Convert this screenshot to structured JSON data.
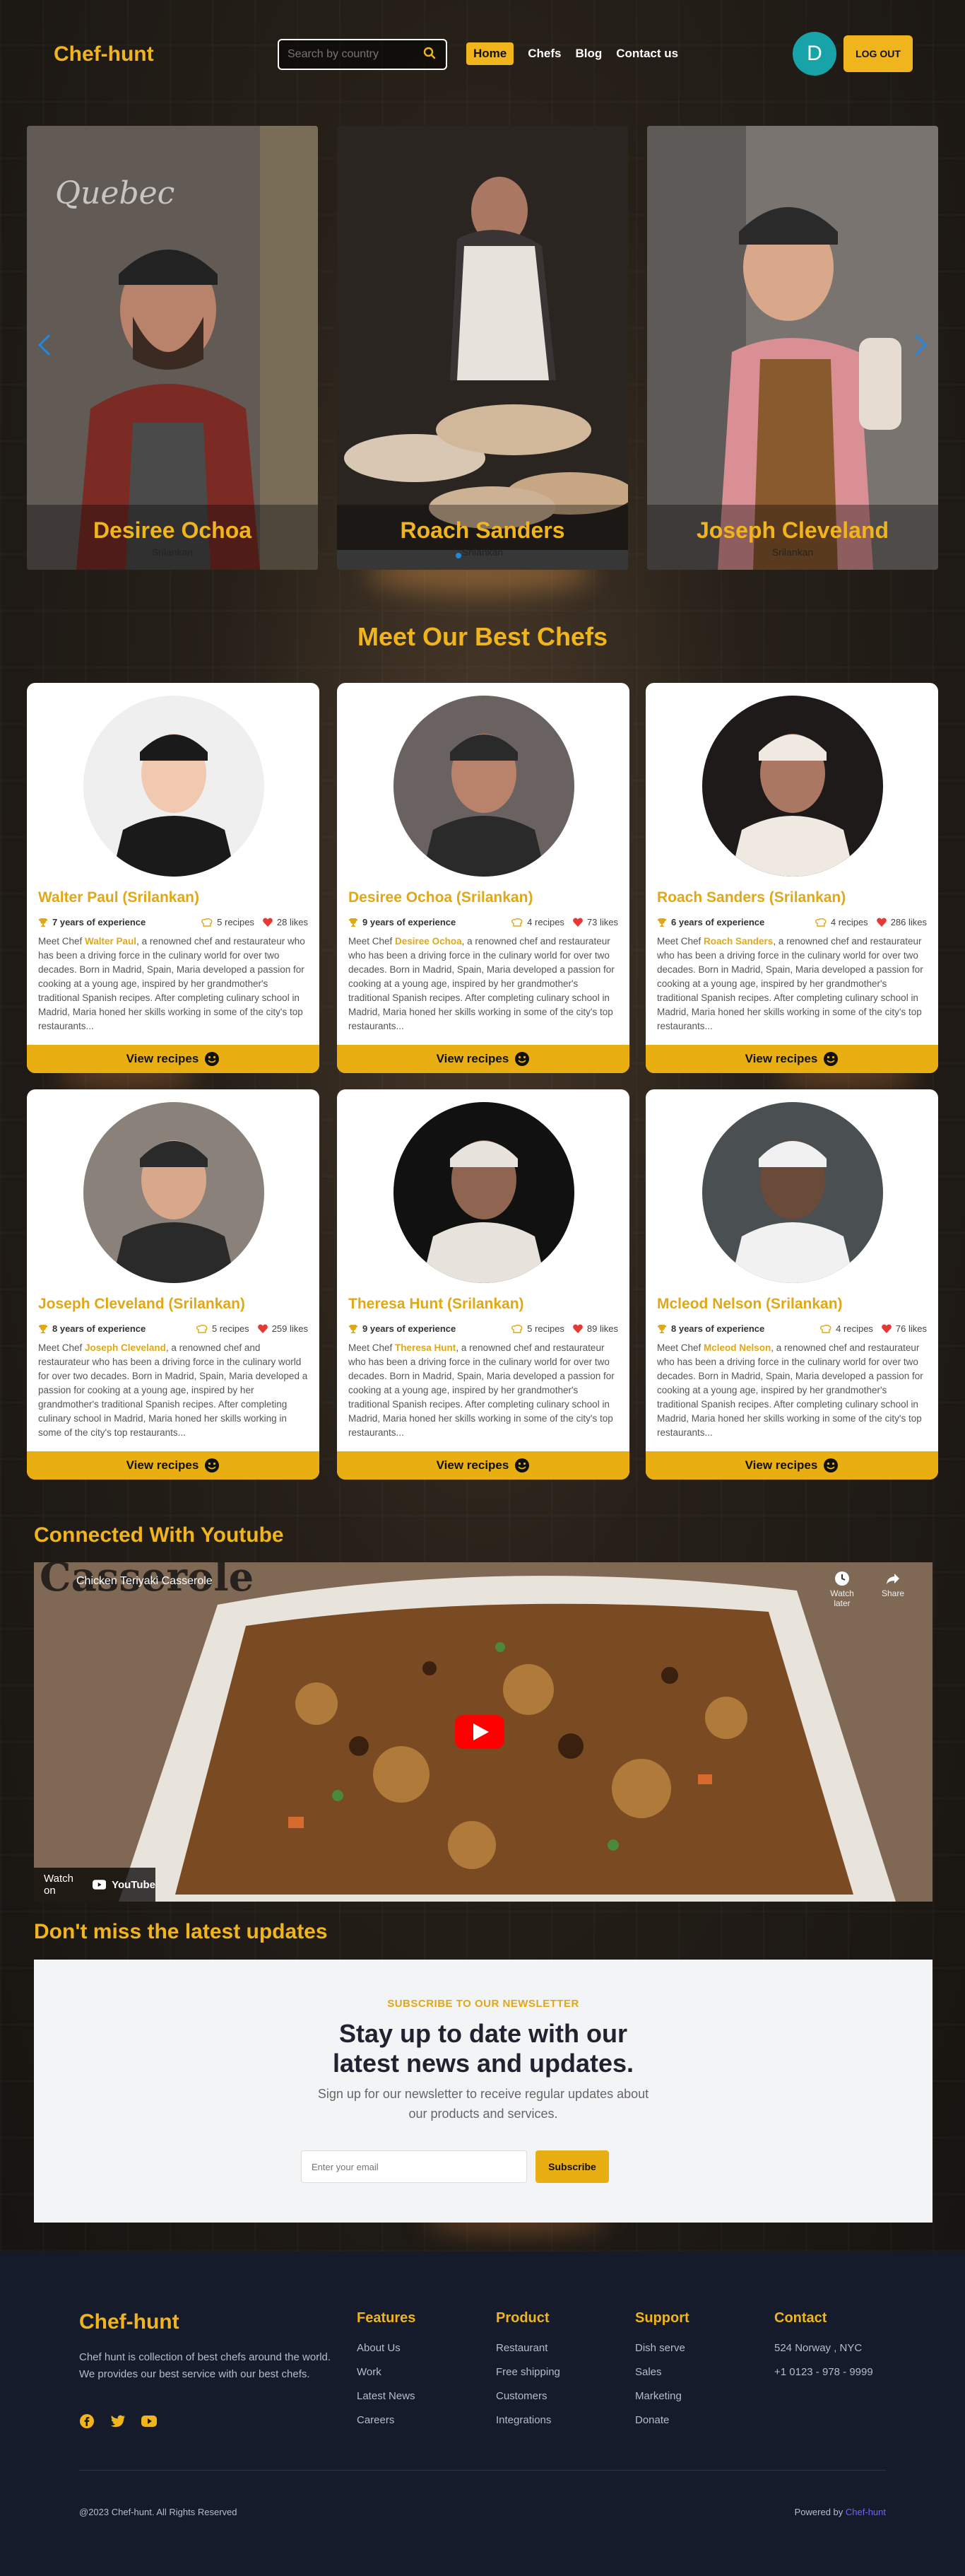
{
  "colors": {
    "accent": "#f0b41c",
    "footer_bg": "#151b2b",
    "avatar": "#18a3a8"
  },
  "nav": {
    "logo": "Chef-hunt",
    "search_placeholder": "Search by country",
    "links": [
      "Home",
      "Chefs",
      "Blog",
      "Contact us"
    ],
    "avatar_letter": "D",
    "logout_label": "LOG OUT"
  },
  "carousel": {
    "slides": [
      {
        "name": "Desiree Ochoa",
        "sub": "Srilankan"
      },
      {
        "name": "Roach Sanders",
        "sub": "Srilankan"
      },
      {
        "name": "Joseph Cleveland",
        "sub": "Srilankan"
      }
    ]
  },
  "chefs_section": {
    "title": "Meet Our Best Chefs",
    "button_label": "View recipes",
    "chefs": [
      {
        "name": "Walter Paul (Srilankan)",
        "short": "Walter Paul",
        "experience": "7 years of experience",
        "recipes": "5 recipes",
        "likes": "28 likes"
      },
      {
        "name": "Desiree Ochoa (Srilankan)",
        "short": "Desiree Ochoa",
        "experience": "9 years of experience",
        "recipes": "4 recipes",
        "likes": "73 likes"
      },
      {
        "name": "Roach Sanders (Srilankan)",
        "short": "Roach Sanders",
        "experience": "6 years of experience",
        "recipes": "4 recipes",
        "likes": "286 likes"
      },
      {
        "name": "Joseph Cleveland (Srilankan)",
        "short": "Joseph Cleveland",
        "experience": "8 years of experience",
        "recipes": "5 recipes",
        "likes": "259 likes"
      },
      {
        "name": "Theresa Hunt (Srilankan)",
        "short": "Theresa Hunt",
        "experience": "9 years of experience",
        "recipes": "5 recipes",
        "likes": "89 likes"
      },
      {
        "name": "Mcleod Nelson (Srilankan)",
        "short": "Mcleod Nelson",
        "experience": "8 years of experience",
        "recipes": "4 recipes",
        "likes": "76 likes"
      }
    ],
    "desc_prefix": "Meet Chef ",
    "desc_suffix": ", a renowned chef and restaurateur who has been a driving force in the culinary world for over two decades. Born in Madrid, Spain, Maria developed a passion for cooking at a young age, inspired by her grandmother's traditional Spanish recipes. After completing culinary school in Madrid, Maria honed her skills working in some of the city's top restaurants..."
  },
  "youtube": {
    "title": "Connected With Youtube",
    "video_title": "Chicken Teriyaki Casserole",
    "overlay_text": "Casserole",
    "watch_later": "Watch later",
    "share": "Share",
    "watch_on": "Watch on",
    "youtube_brand": "YouTube"
  },
  "newsletter": {
    "section_title": "Don't miss the latest updates",
    "eyebrow": "SUBSCRIBE TO OUR NEWSLETTER",
    "heading_line1": "Stay up to date with our",
    "heading_line2": "latest news and updates.",
    "text": "Sign up for our newsletter to receive regular updates about our products and services.",
    "email_placeholder": "Enter your email",
    "button": "Subscribe"
  },
  "footer": {
    "logo": "Chef-hunt",
    "about": "Chef hunt is collection of best chefs around the world. We provides our best service with our best chefs.",
    "columns": [
      {
        "title": "Features",
        "items": [
          "About Us",
          "Work",
          "Latest News",
          "Careers"
        ]
      },
      {
        "title": "Product",
        "items": [
          "Restaurant",
          "Free shipping",
          "Customers",
          "Integrations"
        ]
      },
      {
        "title": "Support",
        "items": [
          "Dish serve",
          "Sales",
          "Marketing",
          "Donate"
        ]
      },
      {
        "title": "Contact",
        "items": [
          "524 Norway , NYC",
          "+1 0123 - 978 - 9999"
        ]
      }
    ],
    "copyright": "@2023 Chef-hunt. All Rights Reserved",
    "powered_label": "Powered by",
    "powered_link": "Chef-hunt"
  }
}
